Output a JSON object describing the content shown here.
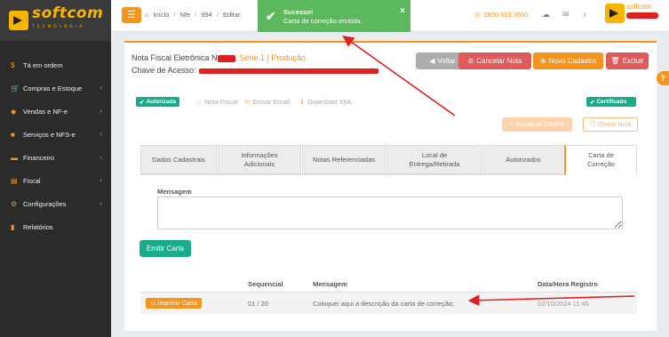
{
  "brand": {
    "name": "softcom",
    "subtitle": "TECNOLOGIA"
  },
  "sidebar": {
    "items": [
      {
        "label": "Tá em ordem",
        "icon": "dollar-icon",
        "has_submenu": false
      },
      {
        "label": "Compras e Estoque",
        "icon": "cart-icon",
        "has_submenu": true
      },
      {
        "label": "Vendas e NF-e",
        "icon": "tag-icon",
        "has_submenu": true
      },
      {
        "label": "Serviços e NFS-e",
        "icon": "briefcase-icon",
        "has_submenu": true
      },
      {
        "label": "Financeiro",
        "icon": "money-icon",
        "has_submenu": true
      },
      {
        "label": "Fiscal",
        "icon": "file-icon",
        "has_submenu": true
      },
      {
        "label": "Configurações",
        "icon": "gears-icon",
        "has_submenu": true
      },
      {
        "label": "Relatórios",
        "icon": "bar-chart-icon",
        "has_submenu": false
      }
    ]
  },
  "header": {
    "breadcrumb": [
      "Início",
      "Nfe",
      "994",
      "Editar"
    ],
    "phone": "0800 003 3600",
    "user_name": "softcom"
  },
  "toast": {
    "title": "Sucesso!",
    "message": "Carta de correção emitida.",
    "color": "#5cb85c"
  },
  "note": {
    "title_prefix": "Nota Fiscal Eletrônica N",
    "title_suffix": ". Série 1 | Produção",
    "key_label": "Chave de Acesso:",
    "status_badge": "Autorizada",
    "certificate_badge": "Certificado"
  },
  "actions": {
    "voltar": "Voltar",
    "cancelar": "Cancelar Nota",
    "novo": "Novo Cadastro",
    "excluir": "Excluir",
    "nota_fiscal": "Nota Fiscal",
    "enviar_email": "Enviar Email",
    "download_xml": "Download XML",
    "visualizar_danfe": "Visualizar DANFe",
    "clonar_nota": "Clonar Nota"
  },
  "tabs": [
    {
      "label": "Dados Cadastrais",
      "active": false
    },
    {
      "label": "Informações Adicionais",
      "active": false
    },
    {
      "label": "Notas Referenciadas",
      "active": false
    },
    {
      "label": "Local de Entrega/Retirada",
      "active": false
    },
    {
      "label": "Autorizados",
      "active": false
    },
    {
      "label": "Carta de Correção",
      "active": true
    }
  ],
  "form": {
    "message_label": "Mensagem",
    "message_value": "",
    "emit_button": "Emitir Carta"
  },
  "table": {
    "headers": [
      "Sequencial",
      "Mensagem",
      "Data/Hora Registro"
    ],
    "rows": [
      {
        "action": "Imprimir Carta",
        "sequencial": "01 / 20",
        "mensagem": "Coloquei aqui a descrição da carta de correção;",
        "data_hora": "02/10/2024 11:45"
      }
    ]
  },
  "colors": {
    "accent": "#f7941d",
    "success": "#1aab8b",
    "danger": "#e05a5a",
    "sidebar": "#2b2b2b"
  }
}
